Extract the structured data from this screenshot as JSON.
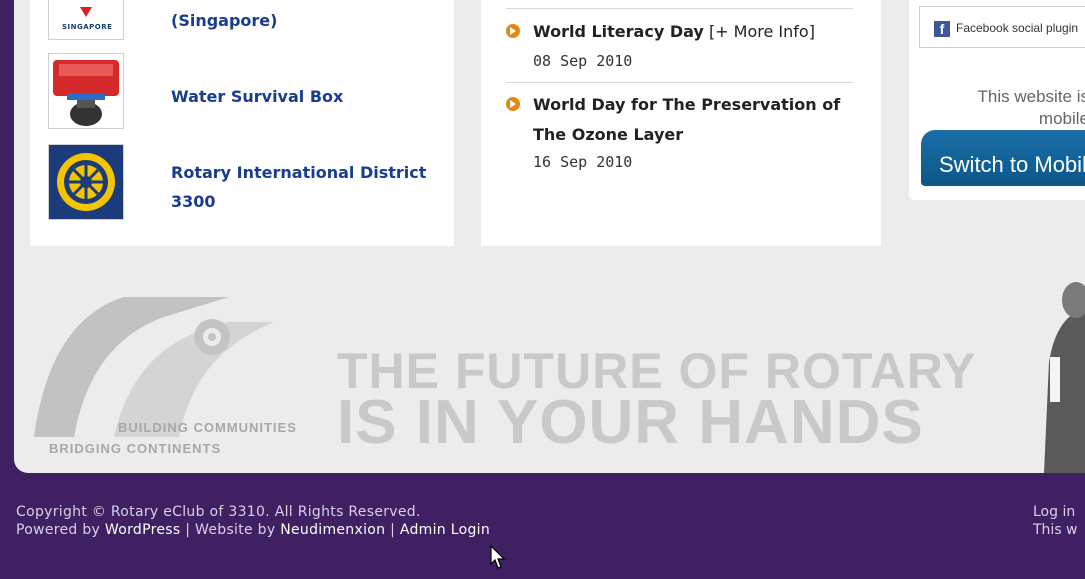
{
  "links": [
    {
      "title": "(Singapore)",
      "thumb_label": "SINGAPORE",
      "icon": "singapore-logo-icon"
    },
    {
      "title": "Water Survival Box",
      "icon": "water-survival-box-icon"
    },
    {
      "title": "Rotary International District 3300",
      "icon": "rotary-wheel-icon"
    }
  ],
  "events": [
    {
      "title": "World Literacy Day",
      "more": "[+ More Info]",
      "date": "08 Sep 2010"
    },
    {
      "title": "World Day for The Preservation of The Ozone Layer",
      "date": "16 Sep 2010"
    }
  ],
  "sidebar": {
    "facebook_plugin": "Facebook social plugin",
    "mobile_text": "This website is mobile",
    "switch_button": "Switch to Mobile"
  },
  "banner": {
    "slogan_line1": "THE FUTURE OF ROTARY",
    "slogan_line2": "IS IN YOUR HANDS",
    "tagline1": "BUILDING COMMUNITIES",
    "tagline2": "BRIDGING CONTINENTS"
  },
  "footer": {
    "copyright": "Copyright © Rotary eClub of 3310. All Rights Reserved.",
    "powered_by": "Powered by",
    "wordpress": "WordPress",
    "sep1": "|",
    "website_by": "Website by",
    "neudimenxion": "Neudimenxion",
    "sep2": "|",
    "admin_login": "Admin Login",
    "log_in": "Log in",
    "this_w": "This w"
  },
  "colors": {
    "purple": "#3f2163",
    "link_blue": "#183d8c",
    "orange_bullet": "#e08a12",
    "switch_blue": "#0b5789"
  }
}
